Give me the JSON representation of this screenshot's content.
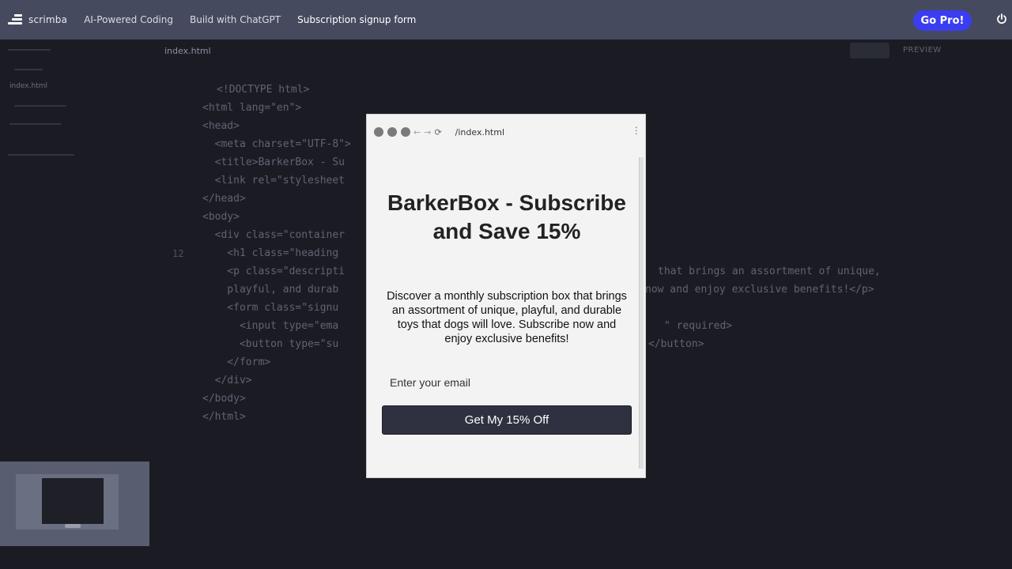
{
  "topbar": {
    "logo_text": "scrimba",
    "breadcrumbs": [
      "AI-Powered Coding",
      "Build with ChatGPT",
      "Subscription signup form"
    ],
    "go_pro_label": "Go Pro!",
    "accent_color": "#3b3df0"
  },
  "sidebar": {
    "active_file": "index.html"
  },
  "editor": {
    "file_tab": "index.html",
    "preview_label": "PREVIEW",
    "line_number_marker": "12",
    "code_lines": [
      "<!DOCTYPE html>",
      "<html lang=\"en\">",
      "<head>",
      "  <meta charset=\"UTF-8\">",
      "  <title>BarkerBox - Su",
      "  <link rel=\"stylesheet",
      "</head>",
      "<body>",
      "  <div class=\"container",
      "    <h1 class=\"heading",
      "    <p class=\"descripti",
      "    playful, and durab",
      "    <form class=\"signu",
      "      <input type=\"ema",
      "      <button type=\"su",
      "    </form>",
      "  </div>",
      "</body>",
      "</html>"
    ],
    "code_right_fragments": [
      "that brings an assortment of unique,",
      "now and enjoy exclusive benefits!</p>",
      "\" required>",
      "</button>"
    ]
  },
  "preview": {
    "url": "/index.html",
    "heading": "BarkerBox - Subscribe and Save 15%",
    "description": "Discover a monthly subscription box that brings an assortment of unique, playful, and durable toys that dogs will love. Subscribe now and enjoy exclusive benefits!",
    "email_placeholder": "Enter your email",
    "cta_label": "Get My 15% Off"
  }
}
